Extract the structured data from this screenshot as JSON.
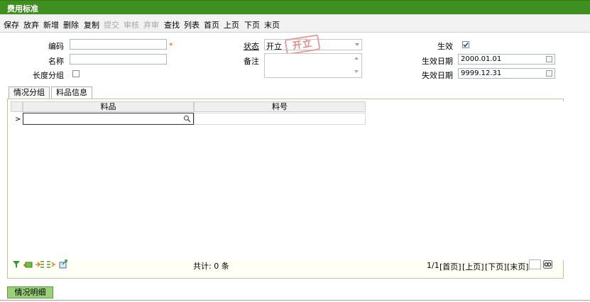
{
  "window": {
    "title": "费用标准"
  },
  "toolbar": [
    {
      "label": "保存",
      "enabled": true
    },
    {
      "label": "放弃",
      "enabled": true
    },
    {
      "label": "新增",
      "enabled": true
    },
    {
      "label": "删除",
      "enabled": true
    },
    {
      "label": "复制",
      "enabled": true
    },
    {
      "label": "提交",
      "enabled": false
    },
    {
      "label": "审核",
      "enabled": false
    },
    {
      "label": "弃审",
      "enabled": false
    },
    {
      "label": "查找",
      "enabled": true
    },
    {
      "label": "列表",
      "enabled": true
    },
    {
      "label": "首页",
      "enabled": true
    },
    {
      "label": "上页",
      "enabled": true
    },
    {
      "label": "下页",
      "enabled": true
    },
    {
      "label": "末页",
      "enabled": true
    }
  ],
  "form": {
    "code_label": "编码",
    "code_value": "",
    "required_mark": "*",
    "name_label": "名称",
    "name_value": "",
    "length_group_label": "长度分组",
    "length_group_checked": false,
    "status_label": "状态",
    "status_value": "开立",
    "stamp_text": "开立",
    "remark_label": "备注",
    "remark_value": "",
    "effective_label": "生效",
    "effective_checked": true,
    "effective_date_label": "生效日期",
    "effective_date_value": "2000.01.01",
    "expiry_date_label": "失效日期",
    "expiry_date_value": "9999.12.31"
  },
  "tabs": [
    {
      "label": "情况分组",
      "active": false
    },
    {
      "label": "料品信息",
      "active": true
    }
  ],
  "grid": {
    "columns": [
      "料品",
      "料号"
    ],
    "row_indicator": ">",
    "count_text": "共计: 0 条"
  },
  "pager": {
    "page_text": "1/1",
    "first": "[首页]",
    "prev": "[上页]",
    "next": "[下页]",
    "last": "[末页]",
    "page_input": ""
  },
  "detail_button": {
    "label": "情况明细"
  },
  "colors": {
    "title_bar": "#3f8f1f",
    "accent_required": "#e25b00",
    "stamp": "#e38b8b",
    "detail_button": "#9ad07a"
  }
}
